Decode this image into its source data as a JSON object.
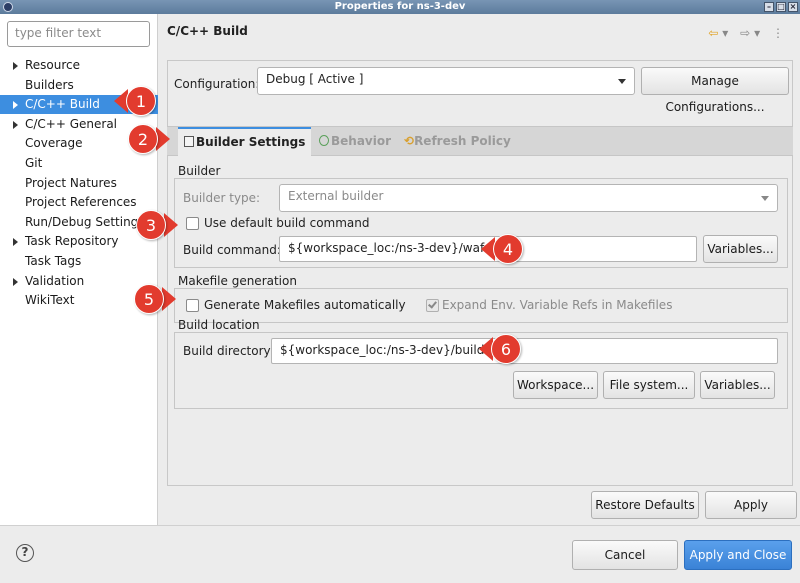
{
  "window": {
    "title": "Properties for ns-3-dev"
  },
  "sidebar": {
    "filter_placeholder": "type filter text",
    "items": [
      {
        "label": "Resource",
        "expandable": true
      },
      {
        "label": "Builders",
        "expandable": false
      },
      {
        "label": "C/C++ Build",
        "expandable": true,
        "selected": true
      },
      {
        "label": "C/C++ General",
        "expandable": true
      },
      {
        "label": "Coverage",
        "expandable": false
      },
      {
        "label": "Git",
        "expandable": false
      },
      {
        "label": "Project Natures",
        "expandable": false
      },
      {
        "label": "Project References",
        "expandable": false
      },
      {
        "label": "Run/Debug Settings",
        "expandable": false
      },
      {
        "label": "Task Repository",
        "expandable": true
      },
      {
        "label": "Task Tags",
        "expandable": false
      },
      {
        "label": "Validation",
        "expandable": true
      },
      {
        "label": "WikiText",
        "expandable": false
      }
    ]
  },
  "main": {
    "title": "C/C++ Build",
    "configuration_label": "Configuration:",
    "configuration_value": "Debug  [ Active ]",
    "manage_button": "Manage Configurations...",
    "tabs": [
      {
        "label": "Builder Settings",
        "active": true
      },
      {
        "label": "Behavior",
        "active": false
      },
      {
        "label": "Refresh Policy",
        "active": false
      }
    ],
    "builder": {
      "group_title": "Builder",
      "type_label": "Builder type:",
      "type_value": "External builder",
      "use_default_label": "Use default build command",
      "use_default_checked": false,
      "command_label": "Build command:",
      "command_value": "${workspace_loc:/ns-3-dev}/waf",
      "variables_button": "Variables..."
    },
    "makefile": {
      "group_title": "Makefile generation",
      "generate_label": "Generate Makefiles automatically",
      "generate_checked": false,
      "expand_label": "Expand Env. Variable Refs in Makefiles",
      "expand_checked": true
    },
    "location": {
      "group_title": "Build location",
      "directory_label": "Build directory:",
      "directory_value": "${workspace_loc:/ns-3-dev}/build",
      "workspace_button": "Workspace...",
      "filesystem_button": "File system...",
      "variables_button": "Variables..."
    },
    "restore_button": "Restore Defaults",
    "apply_button": "Apply"
  },
  "footer": {
    "cancel_button": "Cancel",
    "apply_close_button": "Apply and Close"
  },
  "callouts": [
    "1",
    "2",
    "3",
    "4",
    "5",
    "6"
  ],
  "colors": {
    "accent": "#3d8ee0",
    "callout": "#e23b2e"
  }
}
